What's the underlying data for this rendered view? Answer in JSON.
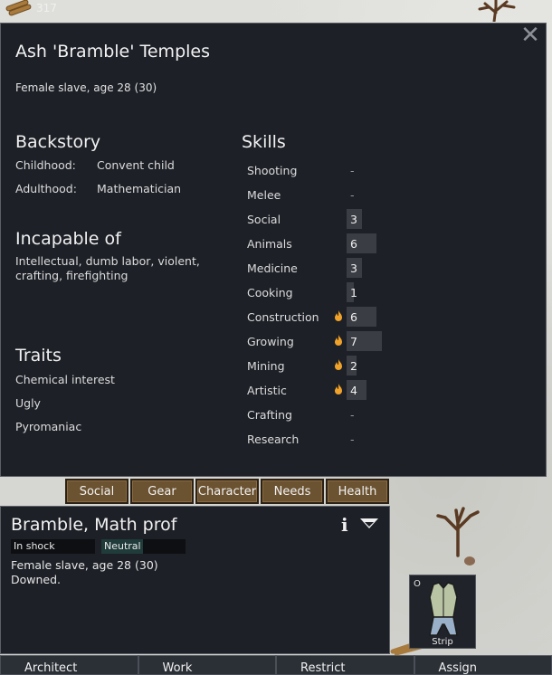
{
  "resource": {
    "icon": "wood-icon",
    "count": "317"
  },
  "card": {
    "name": "Ash 'Bramble' Temples",
    "description": "Female slave, age 28 (30)",
    "backstory": {
      "title": "Backstory",
      "childhood_label": "Childhood:",
      "childhood_value": "Convent child",
      "adulthood_label": "Adulthood:",
      "adulthood_value": "Mathematician"
    },
    "incapable": {
      "title": "Incapable of",
      "text": "Intellectual, dumb labor, violent, crafting, firefighting"
    },
    "traits": {
      "title": "Traits",
      "items": [
        "Chemical interest",
        "Ugly",
        "Pyromaniac"
      ]
    },
    "skills": {
      "title": "Skills",
      "items": [
        {
          "name": "Shooting",
          "level": "-",
          "passion": false
        },
        {
          "name": "Melee",
          "level": "-",
          "passion": false
        },
        {
          "name": "Social",
          "level": "3",
          "passion": false
        },
        {
          "name": "Animals",
          "level": "6",
          "passion": false
        },
        {
          "name": "Medicine",
          "level": "3",
          "passion": false
        },
        {
          "name": "Cooking",
          "level": "1",
          "passion": false
        },
        {
          "name": "Construction",
          "level": "6",
          "passion": true
        },
        {
          "name": "Growing",
          "level": "7",
          "passion": true
        },
        {
          "name": "Mining",
          "level": "2",
          "passion": true
        },
        {
          "name": "Artistic",
          "level": "4",
          "passion": true
        },
        {
          "name": "Crafting",
          "level": "-",
          "passion": false
        },
        {
          "name": "Research",
          "level": "-",
          "passion": false
        }
      ]
    }
  },
  "tabs": [
    "Social",
    "Gear",
    "Character",
    "Needs",
    "Health"
  ],
  "inspect": {
    "title": "Bramble, Math prof",
    "status1": "In shock",
    "status2": "Neutral",
    "line1": "Female slave, age 28 (30)",
    "line2": "Downed."
  },
  "strip_gizmo": {
    "hotkey": "O",
    "label": "Strip"
  },
  "main_buttons": [
    "Architect",
    "Work",
    "Restrict",
    "Assign"
  ],
  "colors": {
    "panel": "#1d2027",
    "tab": "#6b5231",
    "passion": "#f0a22a",
    "skill_bar": "#3a3d44"
  }
}
